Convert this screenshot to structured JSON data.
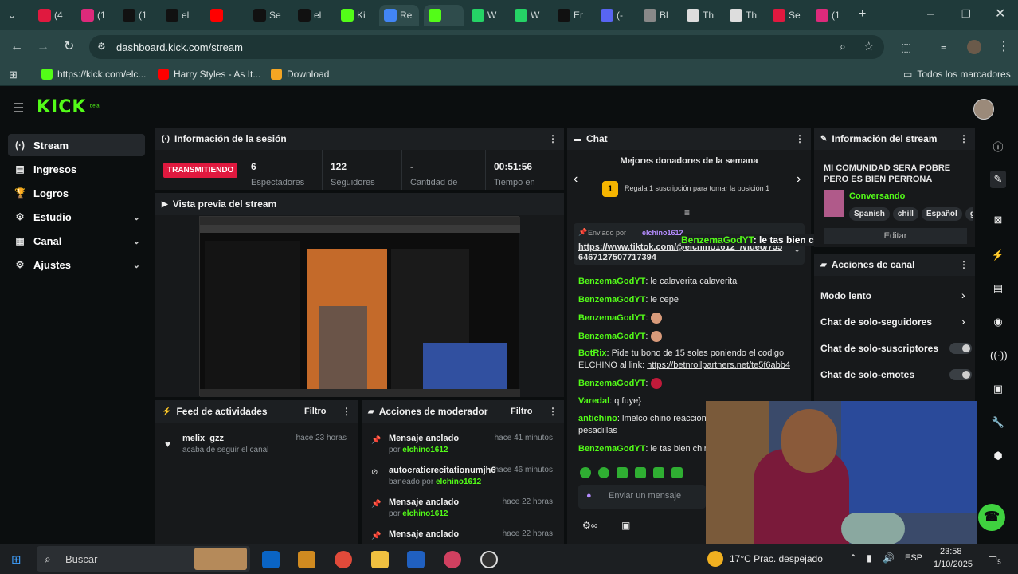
{
  "browser": {
    "tabs": [
      {
        "label": "(4",
        "color": "#e0193f"
      },
      {
        "label": "(1",
        "color": "#dd2a7b"
      },
      {
        "label": "(1",
        "color": "#111111"
      },
      {
        "label": "el",
        "color": "#111111"
      },
      {
        "label": "",
        "color": "#ff0000"
      },
      {
        "label": "Se",
        "color": "#111111"
      },
      {
        "label": "el",
        "color": "#111111"
      },
      {
        "label": "Ki",
        "color": "#53fc18"
      },
      {
        "label": "Re",
        "color": "#4285f4"
      },
      {
        "label": "",
        "color": "#53fc18"
      },
      {
        "label": "W",
        "color": "#25d366"
      },
      {
        "label": "W",
        "color": "#25d366"
      },
      {
        "label": "Er",
        "color": "#111111"
      },
      {
        "label": "(-",
        "color": "#5865f2"
      },
      {
        "label": "Bl",
        "color": "#888888"
      },
      {
        "label": "Th",
        "color": "#dddddd"
      },
      {
        "label": "Th",
        "color": "#dddddd"
      },
      {
        "label": "Se",
        "color": "#e0193f"
      },
      {
        "label": "(1",
        "color": "#dd2a7b"
      }
    ],
    "url": "dashboard.kick.com/stream",
    "bookmarks": [
      {
        "label": "https://kick.com/elc...",
        "color": "#53fc18"
      },
      {
        "label": "Harry Styles - As It...",
        "color": "#ff0000"
      },
      {
        "label": "Download",
        "color": "#f5a623"
      }
    ],
    "all_bookmarks": "Todos los marcadores"
  },
  "app": {
    "logo": "KICK",
    "logo_sup": "beta",
    "sidebar": [
      {
        "label": "Stream",
        "icon": "broadcast-icon",
        "glyph": "(·)",
        "active": true,
        "chevron": false
      },
      {
        "label": "Ingresos",
        "icon": "wallet-icon",
        "glyph": "▤",
        "active": false,
        "chevron": false
      },
      {
        "label": "Logros",
        "icon": "trophy-icon",
        "glyph": "🏆",
        "active": false,
        "chevron": false
      },
      {
        "label": "Estudio",
        "icon": "studio-icon",
        "glyph": "⚙",
        "active": false,
        "chevron": true
      },
      {
        "label": "Canal",
        "icon": "channel-icon",
        "glyph": "▦",
        "active": false,
        "chevron": true
      },
      {
        "label": "Ajustes",
        "icon": "settings-icon",
        "glyph": "⚙",
        "active": false,
        "chevron": true
      }
    ],
    "session": {
      "title": "Información de la sesión",
      "status": "TRANSMITIENDO",
      "stats": [
        {
          "value": "6",
          "label": "Espectadores"
        },
        {
          "value": "122",
          "label": "Seguidores"
        },
        {
          "value": "-",
          "label": "Cantidad de"
        },
        {
          "value": "00:51:56",
          "label": "Tiempo en"
        }
      ]
    },
    "preview": {
      "title": "Vista previa del stream"
    },
    "feed": {
      "title": "Feed de actividades",
      "filter": "Filtro",
      "items": [
        {
          "user": "melix_gzz",
          "text": "acaba de seguir el canal",
          "time": "hace 23 horas"
        }
      ]
    },
    "mod": {
      "title": "Acciones de moderador",
      "filter": "Filtro",
      "items": [
        {
          "title": "Mensaje anclado",
          "prefix": "por",
          "actor": "elchino1612",
          "time": "hace 41 minutos",
          "icon": "pin-icon",
          "glyph": "📌"
        },
        {
          "title": "autocraticrecitationumjh6",
          "prefix": "baneado por",
          "actor": "elchino1612",
          "time": "hace 46 minutos",
          "icon": "ban-icon",
          "glyph": "⊘"
        },
        {
          "title": "Mensaje anclado",
          "prefix": "por",
          "actor": "elchino1612",
          "time": "hace 22 horas",
          "icon": "pin-icon",
          "glyph": "📌"
        },
        {
          "title": "Mensaje anclado",
          "prefix": "",
          "actor": "",
          "time": "hace 22 horas",
          "icon": "pin-icon",
          "glyph": "📌"
        }
      ]
    },
    "chat": {
      "title": "Chat",
      "donors_title": "Mejores donadores de la semana",
      "donors_rank": "1",
      "donors_text": "Regala 1 suscripción para tomar la posición 1",
      "pinned_by": "Enviado por",
      "pinned_user": "elchino1612",
      "pinned_link": "https://www.tiktok.com/@elchino1612_/video/7556467127507717394",
      "overlay_user": "BenzemaGodYT",
      "overlay_text": ": le tas bien chino?",
      "messages": [
        {
          "user": "BenzemaGodYT",
          "text": ": le calaverita calaverita"
        },
        {
          "user": "BenzemaGodYT",
          "text": ": le cepe"
        },
        {
          "user": "BenzemaGodYT",
          "text": ":"
        },
        {
          "user": "BenzemaGodYT",
          "text": ":"
        },
        {
          "user": "BotRix",
          "text": ": Pide tu bono de 15 soles poniendo el codigo ELCHINO al link: ",
          "link": "https://betnrollpartners.net/te5f6abb4"
        },
        {
          "user": "BenzemaGodYT",
          "text": ":"
        },
        {
          "user": "Varedal",
          "text": ": q fuye}"
        },
        {
          "user": "antichino",
          "text": ": lmelco chino reacciona pero una que de pesadillas"
        },
        {
          "user": "BenzemaGodYT",
          "text": ": le tas bien chino?"
        }
      ],
      "input_placeholder": "Enviar un mensaje"
    },
    "stream_info": {
      "title": "Información del stream",
      "stream_title": "MI COMUNIDAD SERA POBRE PERO ES BIEN PERRONA",
      "category": "Conversando",
      "tags": [
        "Spanish",
        "chill",
        "Español",
        "g"
      ],
      "edit": "Editar"
    },
    "channel_actions": {
      "title": "Acciones de canal",
      "items": [
        {
          "label": "Modo lento",
          "control": "chevron"
        },
        {
          "label": "Chat de solo-seguidores",
          "control": "chevron"
        },
        {
          "label": "Chat de solo-suscriptores",
          "control": "toggle"
        },
        {
          "label": "Chat de solo-emotes",
          "control": "toggle"
        }
      ]
    }
  },
  "taskbar": {
    "search": "Buscar",
    "weather": "17°C  Prac. despejado",
    "lang": "ESP",
    "time": "23:58",
    "date": "1/10/2025",
    "notif": "5"
  },
  "colors": {
    "kick_green": "#53fc18",
    "live_red": "#e0193f",
    "panel": "#17191b"
  }
}
